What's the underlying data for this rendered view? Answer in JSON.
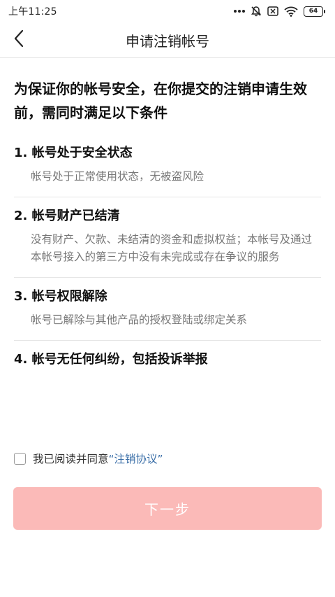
{
  "status_bar": {
    "time": "上午11:25",
    "battery_level": "64",
    "icons": [
      "more-dots-icon",
      "mute-bell-icon",
      "sim-off-icon",
      "wifi-icon",
      "battery-icon"
    ]
  },
  "nav": {
    "title": "申请注销帐号",
    "back_icon": "chevron-left-icon"
  },
  "headline": "为保证你的帐号安全，在你提交的注销申请生效前，需同时满足以下条件",
  "conditions": [
    {
      "title": "1. 帐号处于安全状态",
      "desc": "帐号处于正常使用状态，无被盗风险"
    },
    {
      "title": "2. 帐号财产已结清",
      "desc": "没有财产、欠款、未结清的资金和虚拟权益；本帐号及通过本帐号接入的第三方中没有未完成或存在争议的服务"
    },
    {
      "title": "3. 帐号权限解除",
      "desc": "帐号已解除与其他产品的授权登陆或绑定关系"
    },
    {
      "title": "4. 帐号无任何纠纷，包括投诉举报",
      "desc": ""
    }
  ],
  "agreement": {
    "checked": false,
    "text": "我已阅读并同意",
    "link": "“注销协议”"
  },
  "next_button": {
    "label": "下一步",
    "enabled": false
  },
  "colors": {
    "link": "#3b6fa8",
    "button_disabled": "#fbbab8"
  }
}
